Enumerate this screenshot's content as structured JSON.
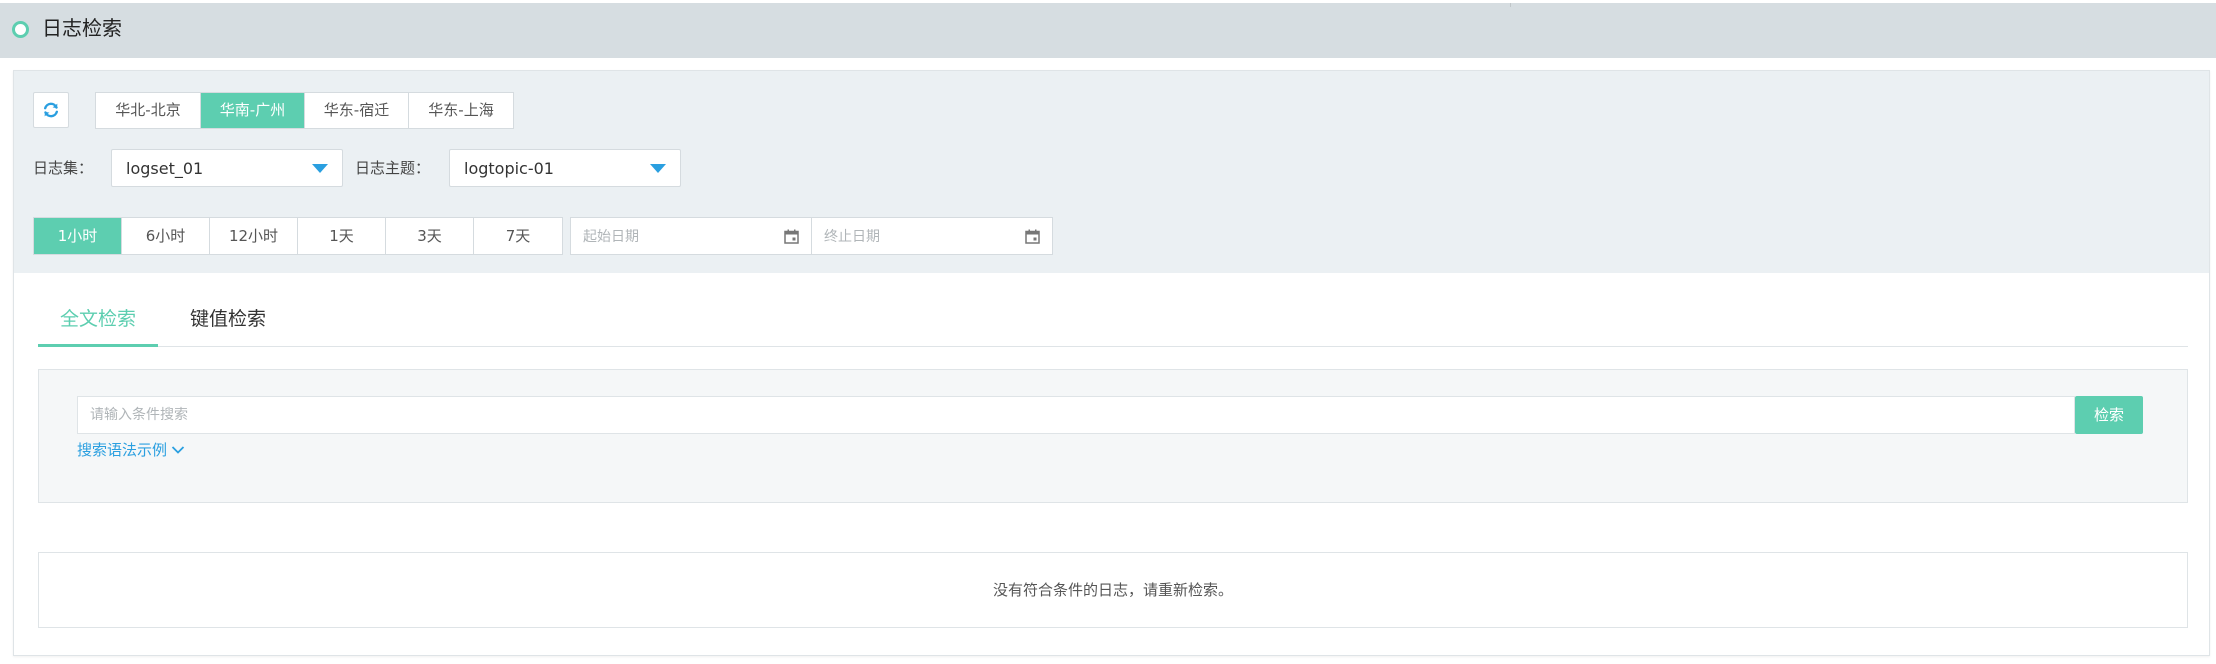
{
  "header": {
    "title": "日志检索"
  },
  "regions": [
    {
      "label": "华北-北京",
      "active": false
    },
    {
      "label": "华南-广州",
      "active": true
    },
    {
      "label": "华东-宿迁",
      "active": false
    },
    {
      "label": "华东-上海",
      "active": false
    }
  ],
  "logset": {
    "label": "日志集：",
    "value": "logset_01"
  },
  "logtopic": {
    "label": "日志主题：",
    "value": "logtopic-01"
  },
  "time_ranges": [
    {
      "label": "1小时",
      "active": true
    },
    {
      "label": "6小时",
      "active": false
    },
    {
      "label": "12小时",
      "active": false
    },
    {
      "label": "1天",
      "active": false
    },
    {
      "label": "3天",
      "active": false
    },
    {
      "label": "7天",
      "active": false
    }
  ],
  "date_range": {
    "start_placeholder": "起始日期",
    "end_placeholder": "终止日期"
  },
  "tabs": [
    {
      "label": "全文检索",
      "active": true
    },
    {
      "label": "键值检索",
      "active": false
    }
  ],
  "search": {
    "placeholder": "请输入条件搜索",
    "button_label": "检索",
    "syntax_link": "搜索语法示例"
  },
  "results": {
    "empty_message": "没有符合条件的日志，请重新检索。"
  },
  "colors": {
    "accent": "#5dceb0",
    "link": "#2a9fe0",
    "header_bg": "#d6dde1",
    "filter_bg": "#ebf0f3"
  }
}
